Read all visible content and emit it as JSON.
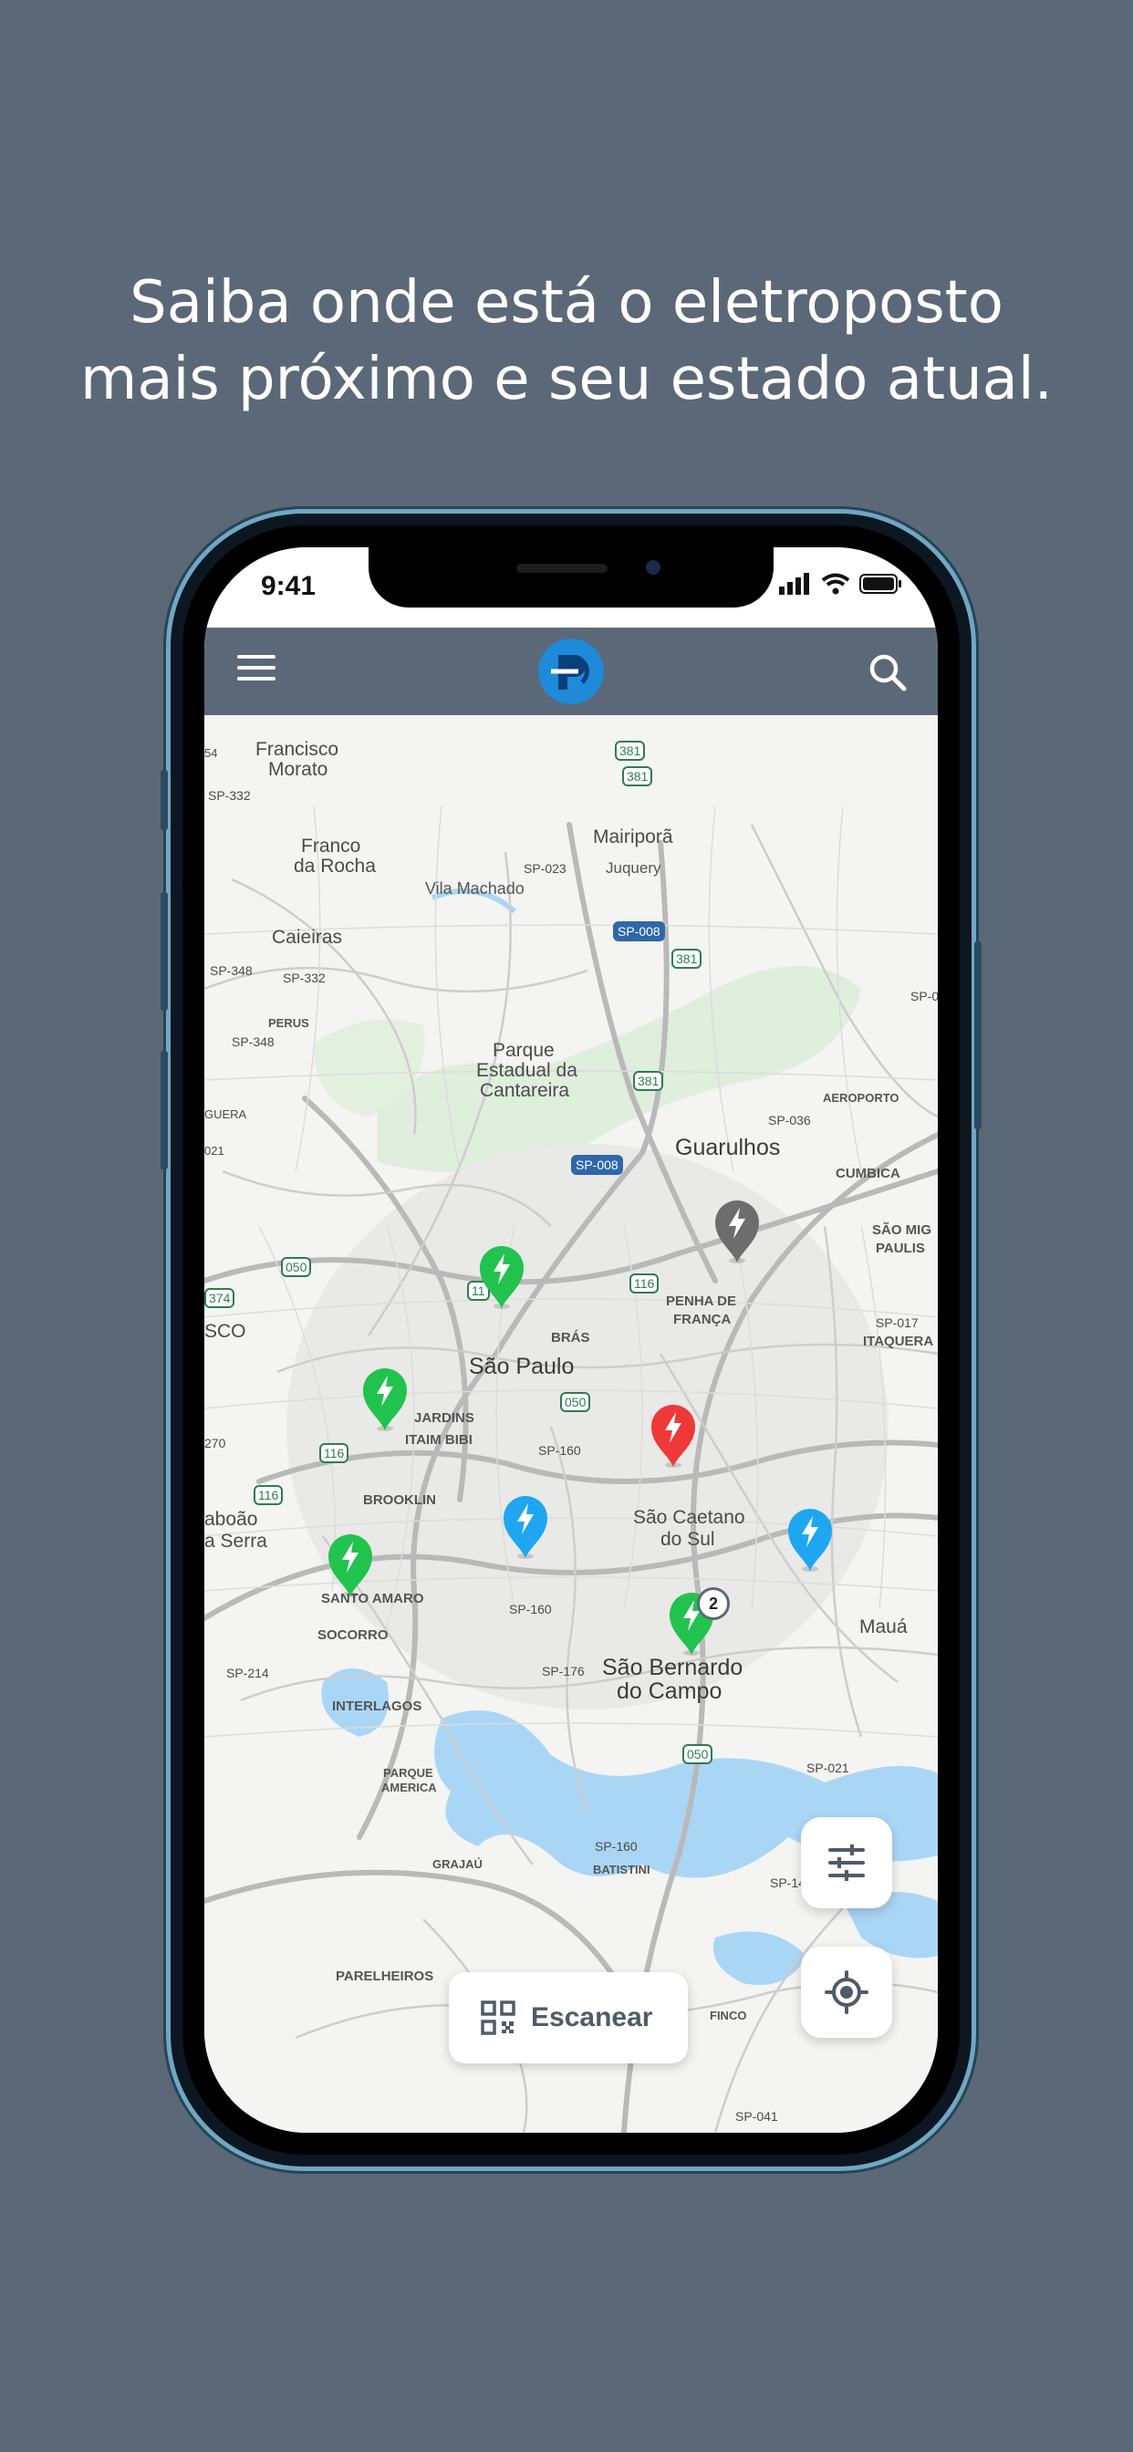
{
  "headline": {
    "line1": "Saiba onde está o eletroposto",
    "line2": "mais próximo e seu estado atual."
  },
  "status_bar": {
    "time": "9:41"
  },
  "app_bar": {
    "menu_icon": "hamburger-menu-icon",
    "logo_icon": "brand-logo",
    "search_icon": "search-icon",
    "color": "#5b6877"
  },
  "map": {
    "labels_big": [
      "São Paulo",
      "Guarulhos",
      "São Caetano",
      "do Sul",
      "São Bernardo",
      "do Campo",
      "Mauá"
    ],
    "labels_mid": [
      "Francisco",
      "Morato",
      "Franco",
      "da Rocha",
      "Caieiras",
      "Mairiporã",
      "Parque",
      "Estadual da",
      "Cantareira",
      "Vila Machado",
      "Juquery",
      "aboão",
      "a Serra",
      "SCO"
    ],
    "labels_small": [
      "JARDINS",
      "ITAIM BIBI",
      "BROOKLIN",
      "SANTO AMARO",
      "SOCORRO",
      "INTERLAGOS",
      "PARQUE",
      "AMERICA",
      "GRAJAÚ",
      "PARELHEIROS",
      "BATISTINI",
      "FINCO",
      "BRÁS",
      "PENHA DE",
      "FRANÇA",
      "AEROPORTO",
      "CUMBICA",
      "SÃO MIG",
      "PAULIS",
      "ITAQUERA",
      "PERUS"
    ],
    "road_shields": [
      "381",
      "381",
      "381",
      "381",
      "116",
      "116",
      "116",
      "050",
      "050",
      "050",
      "374",
      "11",
      "SP-008",
      "SP-008"
    ],
    "road_labels": [
      "SP-332",
      "SP-332",
      "SP-023",
      "SP-348",
      "SP-348",
      "SP-036",
      "SP-017",
      "SP-021",
      "SP-160",
      "SP-160",
      "SP-160",
      "SP-176",
      "SP-214",
      "SP-041",
      "SP-14",
      "SP-0",
      "270",
      "GUERA",
      "021",
      "54"
    ]
  },
  "stations": [
    {
      "status": "available",
      "color": "#22c24e",
      "icon": "bolt-icon"
    },
    {
      "status": "available",
      "color": "#22c24e",
      "icon": "bolt-icon"
    },
    {
      "status": "available",
      "color": "#22c24e",
      "icon": "bolt-icon"
    },
    {
      "status": "available",
      "color": "#22c24e",
      "icon": "bolt-icon"
    },
    {
      "status": "in-use",
      "color": "#1ea7f0",
      "icon": "bolt-icon"
    },
    {
      "status": "in-use",
      "color": "#1ea7f0",
      "icon": "bolt-icon"
    },
    {
      "status": "unavailable",
      "color": "#ef3838",
      "icon": "bolt-icon"
    },
    {
      "status": "offline",
      "color": "#6d6d6d",
      "icon": "bolt-icon"
    }
  ],
  "cluster_badge": "2",
  "controls": {
    "filter_icon": "sliders-icon",
    "locate_icon": "my-location-icon",
    "scan_label": "Escanear",
    "scan_icon": "qr-code-icon"
  }
}
